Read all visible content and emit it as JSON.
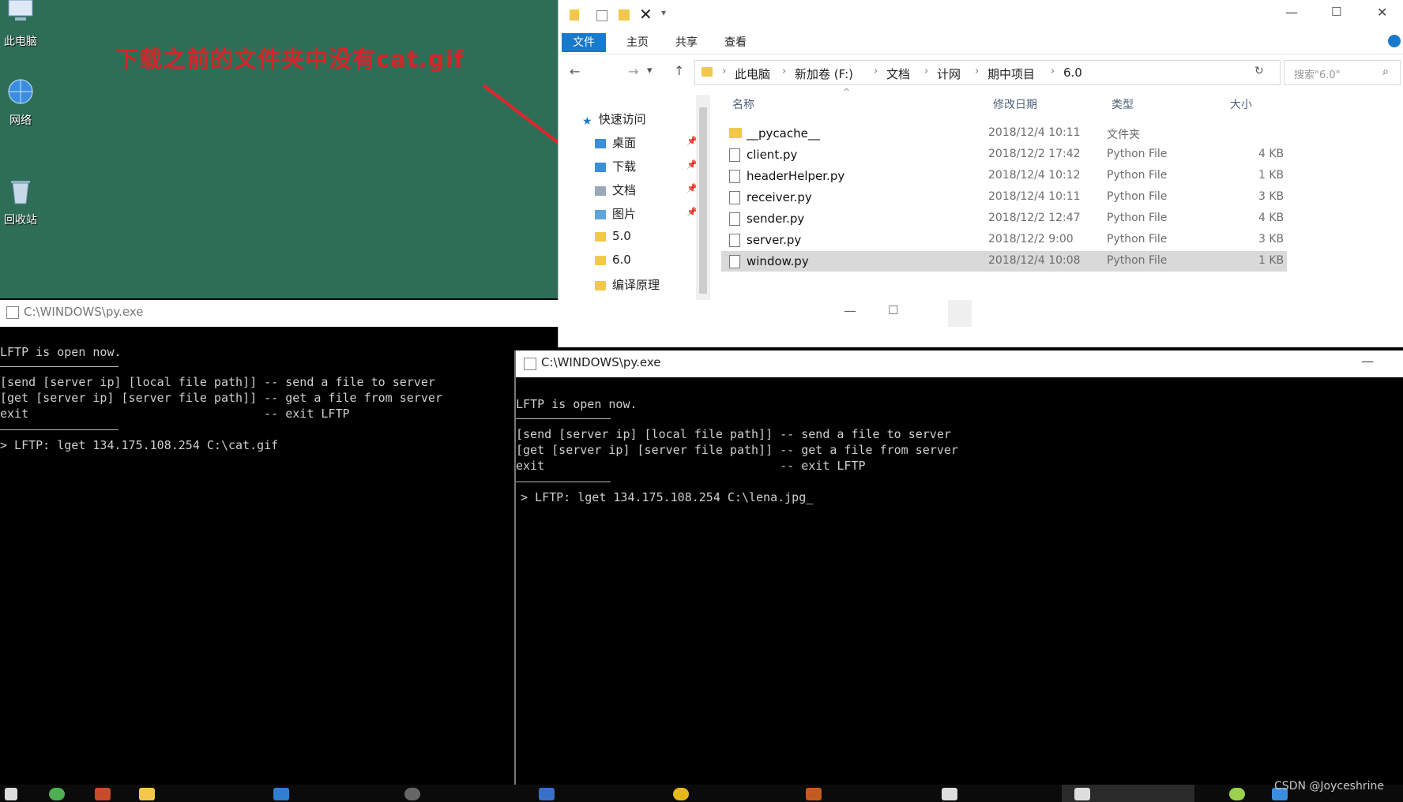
{
  "desktop": {
    "icons": [
      "此电脑",
      "网络",
      "回收站"
    ],
    "annotation": "下载之前的文件夹中没有cat.gif"
  },
  "explorer": {
    "ribbon_tabs": [
      "文件",
      "主页",
      "共享",
      "查看"
    ],
    "breadcrumb": [
      "此电脑",
      "新加卷 (F:)",
      "文档",
      "计网",
      "期中项目",
      "6.0"
    ],
    "search_placeholder": "搜索\"6.0\"",
    "nav": {
      "quick_access": "快速访问",
      "items": [
        "桌面",
        "下载",
        "文档",
        "图片",
        "5.0",
        "6.0",
        "编译原理"
      ]
    },
    "columns": [
      "名称",
      "修改日期",
      "类型",
      "大小"
    ],
    "files": [
      {
        "name": "__pycache__",
        "date": "2018/12/4 10:11",
        "type": "文件夹",
        "size": ""
      },
      {
        "name": "client.py",
        "date": "2018/12/2 17:42",
        "type": "Python File",
        "size": "4 KB"
      },
      {
        "name": "headerHelper.py",
        "date": "2018/12/4 10:12",
        "type": "Python File",
        "size": "1 KB"
      },
      {
        "name": "receiver.py",
        "date": "2018/12/4 10:11",
        "type": "Python File",
        "size": "3 KB"
      },
      {
        "name": "sender.py",
        "date": "2018/12/2 12:47",
        "type": "Python File",
        "size": "4 KB"
      },
      {
        "name": "server.py",
        "date": "2018/12/2 9:00",
        "type": "Python File",
        "size": "3 KB"
      },
      {
        "name": "window.py",
        "date": "2018/12/4 10:08",
        "type": "Python File",
        "size": "1 KB"
      }
    ]
  },
  "console_back": {
    "title": "C:\\WINDOWS\\py.exe",
    "lines": [
      "LFTP is open now.",
      "[send [server ip] [local file path]] -- send a file to server",
      "[get [server ip] [server file path]] -- get a file from server",
      "exit                                 -- exit LFTP",
      "> LFTP: lget 134.175.108.254 C:\\cat.gif"
    ]
  },
  "console_front": {
    "title": "C:\\WINDOWS\\py.exe",
    "lines": [
      "LFTP is open now.",
      "[send [server ip] [local file path]] -- send a file to server",
      "[get [server ip] [server file path]] -- get a file from server",
      "exit                                 -- exit LFTP",
      "> LFTP: lget 134.175.108.254 C:\\lena.jpg"
    ]
  },
  "watermark": "CSDN @Joyceshrine",
  "colors": {
    "desktop_bg": "#2e6e57",
    "annotation": "#d3262a",
    "ribbon_file_tab": "#1979ca",
    "selected_row": "#d9d9d9",
    "console_bg": "#000000"
  }
}
